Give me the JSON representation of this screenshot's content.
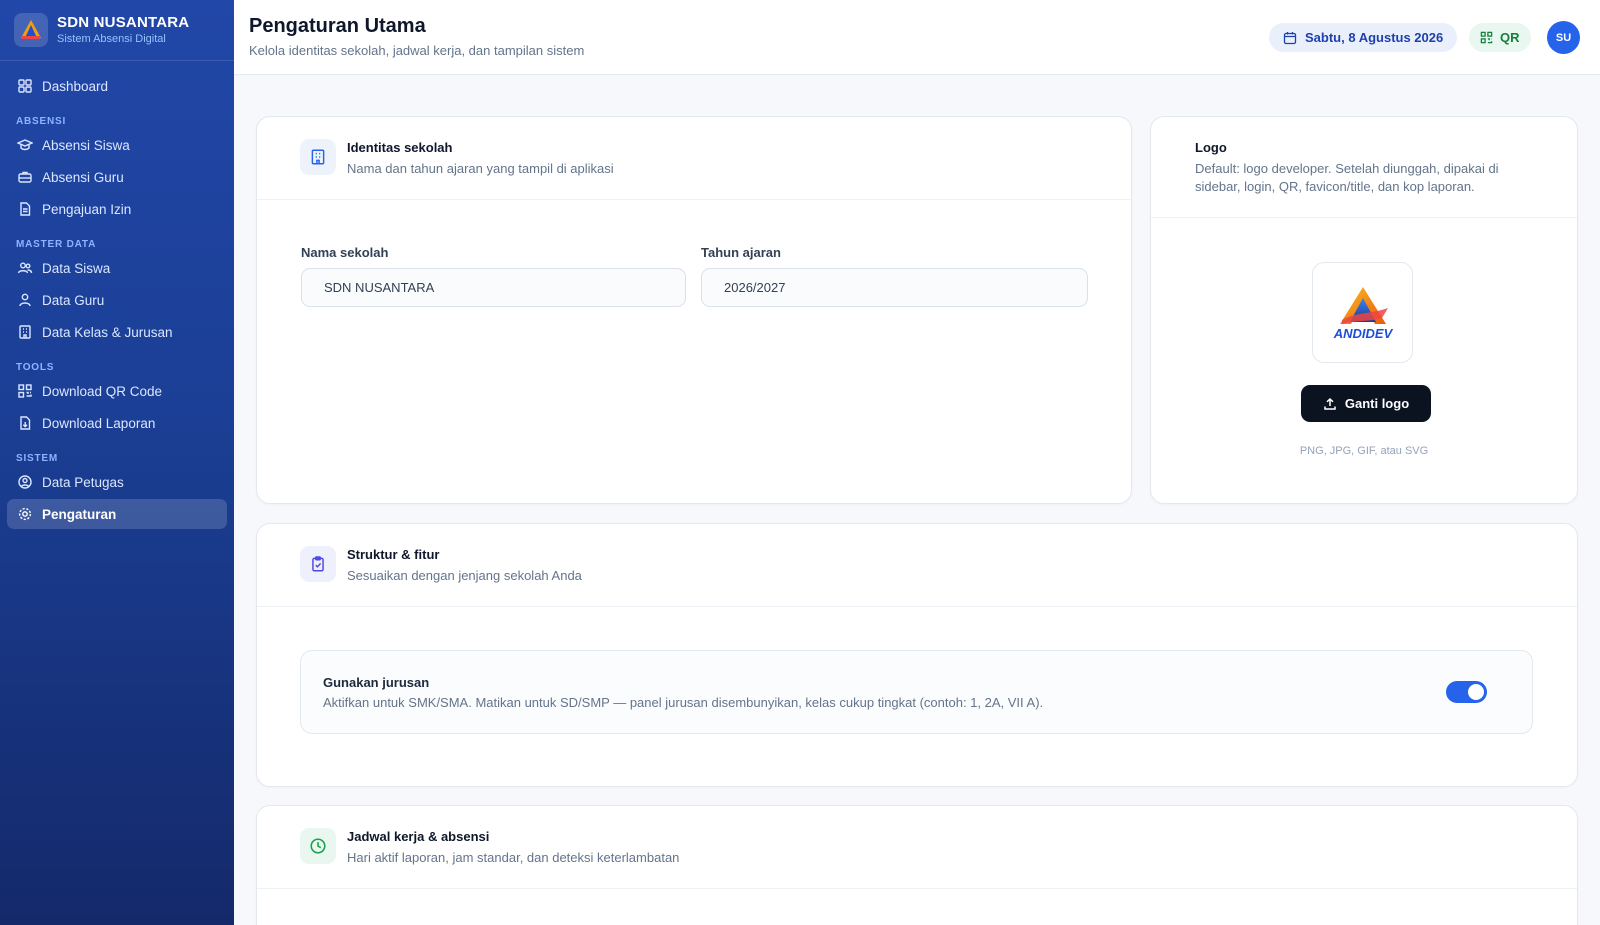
{
  "brand": {
    "name": "SDN NUSANTARA",
    "subtitle": "Sistem Absensi Digital"
  },
  "sidebar": {
    "dashboard": "Dashboard",
    "sections": {
      "absensi": "ABSENSI",
      "master": "MASTER DATA",
      "tools": "TOOLS",
      "sistem": "SISTEM"
    },
    "items": {
      "absensi_siswa": "Absensi Siswa",
      "absensi_guru": "Absensi Guru",
      "pengajuan_izin": "Pengajuan Izin",
      "data_siswa": "Data Siswa",
      "data_guru": "Data Guru",
      "data_kelas": "Data Kelas & Jurusan",
      "download_qr": "Download QR Code",
      "download_laporan": "Download Laporan",
      "data_petugas": "Data Petugas",
      "pengaturan": "Pengaturan"
    },
    "active": "pengaturan"
  },
  "header": {
    "title": "Pengaturan Utama",
    "subtitle": "Kelola identitas sekolah, jadwal kerja, dan tampilan sistem",
    "date": "Sabtu, 8 Agustus 2026",
    "qr_label": "QR",
    "avatar_initials": "SU"
  },
  "identity": {
    "title": "Identitas sekolah",
    "desc": "Nama dan tahun ajaran yang tampil di aplikasi",
    "school_name_label": "Nama sekolah",
    "school_name_value": "SDN NUSANTARA",
    "year_label": "Tahun ajaran",
    "year_value": "2026/2027"
  },
  "logo": {
    "title": "Logo",
    "desc": "Default: logo developer. Setelah diunggah, dipakai di sidebar, login, QR, favicon/title, dan kop laporan.",
    "logo_text": "ANDIDEV",
    "button": "Ganti logo",
    "formats": "PNG, JPG, GIF, atau SVG"
  },
  "structure": {
    "title": "Struktur & fitur",
    "desc": "Sesuaikan dengan jenjang sekolah Anda",
    "toggle_title": "Gunakan jurusan",
    "toggle_desc": "Aktifkan untuk SMK/SMA. Matikan untuk SD/SMP — panel jurusan disembunyikan, kelas cukup tingkat (contoh: 1, 2A, VII A).",
    "toggle_on": true
  },
  "schedule": {
    "title": "Jadwal kerja & absensi",
    "desc": "Hari aktif laporan, jam standar, dan deteksi keterlambatan"
  },
  "colors": {
    "sidebar_top": "#2147a8",
    "sidebar_bottom": "#14296a",
    "accent": "#2563eb",
    "success": "#15803d"
  }
}
